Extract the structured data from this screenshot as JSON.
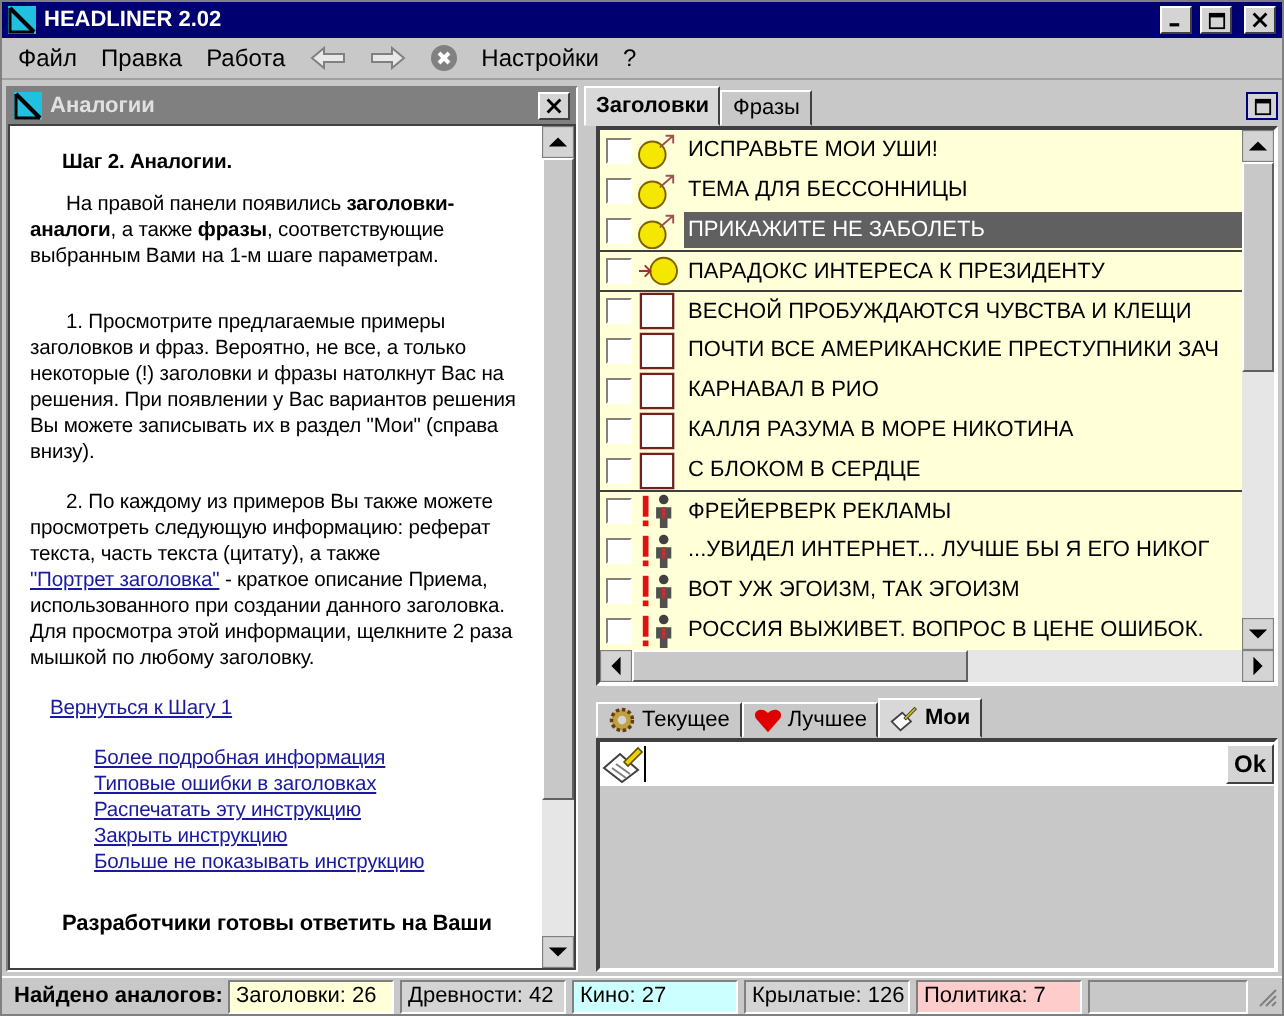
{
  "window": {
    "title": "HEADLINER 2.02"
  },
  "menu": [
    {
      "kind": "text",
      "label": "Файл"
    },
    {
      "kind": "text",
      "label": "Правка"
    },
    {
      "kind": "text",
      "label": "Работа"
    },
    {
      "kind": "back"
    },
    {
      "kind": "forward"
    },
    {
      "kind": "stop"
    },
    {
      "kind": "text",
      "label": "Настройки"
    },
    {
      "kind": "text",
      "label": "?"
    }
  ],
  "left_panel": {
    "title": "Аналогии",
    "heading": "Шаг 2. Аналогии.",
    "paragraphs": [
      {
        "text": "На правой панели появились **заголовки-аналоги**, а также **фразы**, соответствующие выбранным Вами на  1-м шаге параметрам."
      },
      {
        "text": "1. Просмотрите предлагаемые примеры заголовков и фраз.  Вероятно, не все, а только некоторые (!) заголовки и фразы натолкнут Вас на решения. При появлении у Вас вариантов решения Вы можете записывать их в раздел \"Мои\" (справа внизу)."
      },
      {
        "text": "2. По каждому из примеров Вы также можете просмотреть следующую информацию: реферат текста, часть текста (цитату), а также ",
        "link": "\"Портрет заголовка\"",
        "after": " - краткое описание Приема, использованного при создании данного заголовка. Для просмотра этой информации, щелкните 2 раза мышкой по любому заголовку."
      }
    ],
    "back_link": "Вернуться к Шагу 1",
    "links": [
      "Более подробная информация",
      "Типовые ошибки в заголовках",
      "Распечатать эту инструкцию",
      "Закрыть инструкцию",
      "Больше не показывать инструкцию"
    ],
    "footer": "Разработчики готовы ответить на Ваши"
  },
  "headline_tabs": [
    {
      "label": "Заголовки",
      "selected": true
    },
    {
      "label": "Фразы",
      "selected": false
    }
  ],
  "headlines": [
    {
      "kind": "male",
      "text": "ИСПРАВЬТЕ МОИ УШИ!",
      "checked": false,
      "selected": false
    },
    {
      "kind": "male",
      "text": "ТЕМА ДЛЯ БЕССОННИЦЫ",
      "checked": false,
      "selected": false
    },
    {
      "kind": "male",
      "text": "ПРИКАЖИТЕ НЕ ЗАБОЛЕТЬ",
      "checked": false,
      "selected": true
    },
    {
      "kind": "enter",
      "text": "ПАРАДОКС ИНТЕРЕСА К ПРЕЗИДЕНТУ",
      "checked": false,
      "selected": false
    },
    {
      "kind": "square",
      "text": "ВЕСНОЙ ПРОБУЖДАЮТСЯ ЧУВСТВА И КЛЕЩИ",
      "checked": false,
      "selected": false
    },
    {
      "kind": "square",
      "text": "ПОЧТИ ВСЕ АМЕРИКАНСКИЕ ПРЕСТУПНИКИ ЗАЧ",
      "checked": false,
      "selected": false
    },
    {
      "kind": "square",
      "text": "КАРНАВАЛ В РИО",
      "checked": false,
      "selected": false
    },
    {
      "kind": "square",
      "text": "КАЛЛЯ РАЗУМА В МОРЕ НИКОТИНА",
      "checked": false,
      "selected": false
    },
    {
      "kind": "square",
      "text": "С БЛОКОМ В СЕРДЦЕ",
      "checked": false,
      "selected": false
    },
    {
      "kind": "person",
      "text": "ФРЕЙЕРВЕРК РЕКЛАМЫ",
      "checked": false,
      "selected": false
    },
    {
      "kind": "person",
      "text": "...УВИДЕЛ ИНТЕРНЕТ... ЛУЧШЕ БЫ Я ЕГО НИКОГ",
      "checked": false,
      "selected": false
    },
    {
      "kind": "person",
      "text": "ВОТ УЖ ЭГОИЗМ, ТАК ЭГОИЗМ",
      "checked": false,
      "selected": false
    },
    {
      "kind": "person",
      "text": "РОССИЯ ВЫЖИВЕТ. ВОПРОС В ЦЕНЕ ОШИБОК.",
      "checked": false,
      "selected": false
    }
  ],
  "bottom_tabs": [
    {
      "kind": "gear",
      "label": "Текущее",
      "selected": false
    },
    {
      "kind": "heart",
      "label": "Лучшее",
      "selected": false
    },
    {
      "kind": "pen",
      "label": "Мои",
      "selected": true
    }
  ],
  "entry": {
    "button": "Ok"
  },
  "status_bar": {
    "label": "Найдено аналогов:",
    "counts": [
      {
        "text": "Заголовки: 26",
        "color": "#ffffd8"
      },
      {
        "text": "Древности: 42",
        "color": "#d4d4d4"
      },
      {
        "text": "Кино: 27",
        "color": "#ccffff"
      },
      {
        "text": "Крылатые: 126",
        "color": "#d4d4d4"
      },
      {
        "text": "Политика: 7",
        "color": "#ffcccc"
      }
    ]
  }
}
